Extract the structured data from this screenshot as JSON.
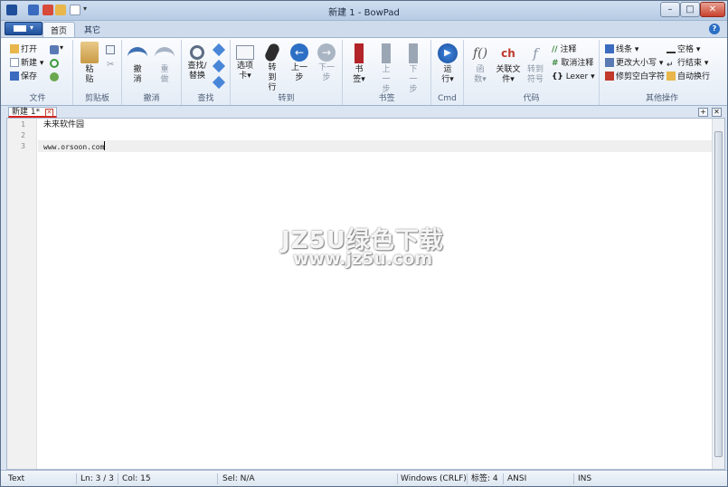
{
  "window": {
    "title": "新建 1 - BowPad"
  },
  "tabs": {
    "home": "首页",
    "other": "其它"
  },
  "ribbon": {
    "file": {
      "open": "打开",
      "new": "新建 ▾",
      "save": "保存",
      "label": "文件"
    },
    "clipboard": {
      "paste": "粘贴",
      "label": "剪贴板"
    },
    "undo": {
      "undo": "撤消",
      "redo": "重做",
      "label": "撤消"
    },
    "find": {
      "find_replace": "查找/替换",
      "label": "查找"
    },
    "goto": {
      "tabs": "选项卡▾",
      "goto_line": "转到行",
      "prev": "上一步",
      "next": "下一步",
      "label": "转到"
    },
    "bookmarks": {
      "bookmark": "书签▾",
      "prev": "上一步",
      "next": "下一步",
      "label": "书签"
    },
    "cmd": {
      "run": "运行▾",
      "label": "Cmd"
    },
    "code": {
      "function": "函数▾",
      "related": "关联文件▾",
      "goto_symbol": "转到符号",
      "comment": "注释",
      "uncomment": "取消注释",
      "lexer": "Lexer ▾",
      "label": "代码"
    },
    "other": {
      "lines": "线条 ▾",
      "change_case": "更改大小写 ▾",
      "trim": "修剪空白字符",
      "spaces": "空格 ▾",
      "eol": "行结束 ▾",
      "autowrap": "自动换行",
      "label": "其他操作"
    }
  },
  "doc_tab": {
    "label": "新建 1",
    "modified": "*"
  },
  "editor": {
    "lines": [
      {
        "num": "1",
        "text": "未来软件园"
      },
      {
        "num": "2",
        "text": ""
      },
      {
        "num": "3",
        "text": "www.orsoon.com"
      }
    ]
  },
  "watermark": {
    "line1": "JZ5U绿色下载",
    "line2": "www.jz5u.com"
  },
  "status": {
    "lexer": "Text",
    "line": "Ln: 3 / 3",
    "col": "Col: 15",
    "sel": "Sel: N/A",
    "eol": "Windows (CRLF)",
    "tabs": "标签: 4",
    "encoding": "ANSI",
    "mode": "INS"
  },
  "colors": {
    "accent": "#2b6fc4",
    "modified_tab": "#d8231f",
    "status_bg": "#dde6f1"
  }
}
